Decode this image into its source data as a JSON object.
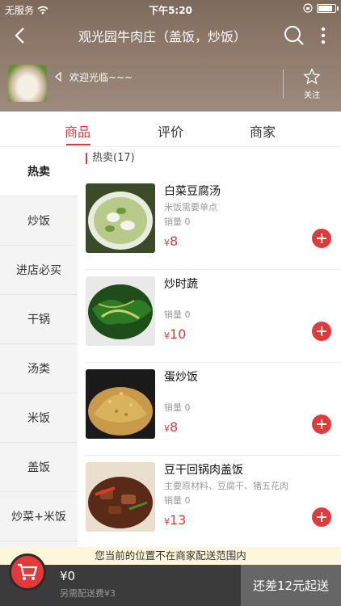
{
  "statusbar": {
    "carrier": "无服务",
    "time": "下午5:20",
    "battery_level": 0.9
  },
  "navbar": {
    "title": "观光园牛肉庄（盖饭，炒饭）"
  },
  "shop": {
    "notice": "欢迎光临~~~",
    "follow_label": "关注"
  },
  "tabs": [
    {
      "label": "商品"
    },
    {
      "label": "评价"
    },
    {
      "label": "商家"
    }
  ],
  "sidebar": {
    "items": [
      {
        "label": "热卖"
      },
      {
        "label": "炒饭"
      },
      {
        "label": "进店必买"
      },
      {
        "label": "干锅"
      },
      {
        "label": "汤类"
      },
      {
        "label": "米饭"
      },
      {
        "label": "盖饭"
      },
      {
        "label": "炒菜+米饭"
      }
    ]
  },
  "section": {
    "title": "热卖(17)"
  },
  "products": [
    {
      "name": "白菜豆腐汤",
      "desc": "米饭需要单点",
      "sales": "销量 0",
      "currency": "¥",
      "price": "8"
    },
    {
      "name": "炒时蔬",
      "desc": "",
      "sales": "销量 0",
      "currency": "¥",
      "price": "10"
    },
    {
      "name": "蛋炒饭",
      "desc": "",
      "sales": "销量 0",
      "currency": "¥",
      "price": "8"
    },
    {
      "name": "豆干回锅肉盖饭",
      "desc": "主要原材料、豆腐干、猪五花肉",
      "sales": "销量 0",
      "currency": "¥",
      "price": "13"
    }
  ],
  "notice_bar": {
    "text": "您当前的位置不在商家配送范围内"
  },
  "cart": {
    "total": "¥0",
    "delivery_fee": "另需配送费¥3",
    "checkout_label": "还差12元起送"
  },
  "colors": {
    "accent": "#e23a3a",
    "bar": "#3b3b3b",
    "notice_bg": "#fdf6da"
  }
}
